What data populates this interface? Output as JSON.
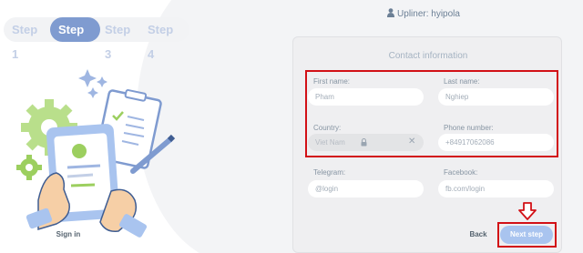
{
  "steps": [
    {
      "label": "Step 1",
      "active": false
    },
    {
      "label": "Step 2",
      "active": true
    },
    {
      "label": "Step 3",
      "active": false
    },
    {
      "label": "Step 4",
      "active": false
    }
  ],
  "header": {
    "upliner": "Upliner: hyipola"
  },
  "form": {
    "title": "Contact information",
    "first_name": {
      "label": "First name:",
      "value": "Pham"
    },
    "last_name": {
      "label": "Last name:",
      "value": "Nghiep"
    },
    "country": {
      "label": "Country:",
      "value": "Viet Nam"
    },
    "phone": {
      "label": "Phone number:",
      "value": "+84917062086"
    },
    "telegram": {
      "label": "Telegram:",
      "placeholder": "@login"
    },
    "facebook": {
      "label": "Facebook:",
      "placeholder": "fb.com/login"
    }
  },
  "buttons": {
    "signin": "Sign in",
    "back": "Back",
    "next": "Next step"
  },
  "colors": {
    "accent": "#7f9bd0",
    "next_button": "#a9c4ef",
    "highlight": "#d21016"
  },
  "icons": {
    "user": "user-icon",
    "lock": "lock-icon",
    "clear": "clear-x-icon",
    "arrow": "down-arrow-icon"
  }
}
